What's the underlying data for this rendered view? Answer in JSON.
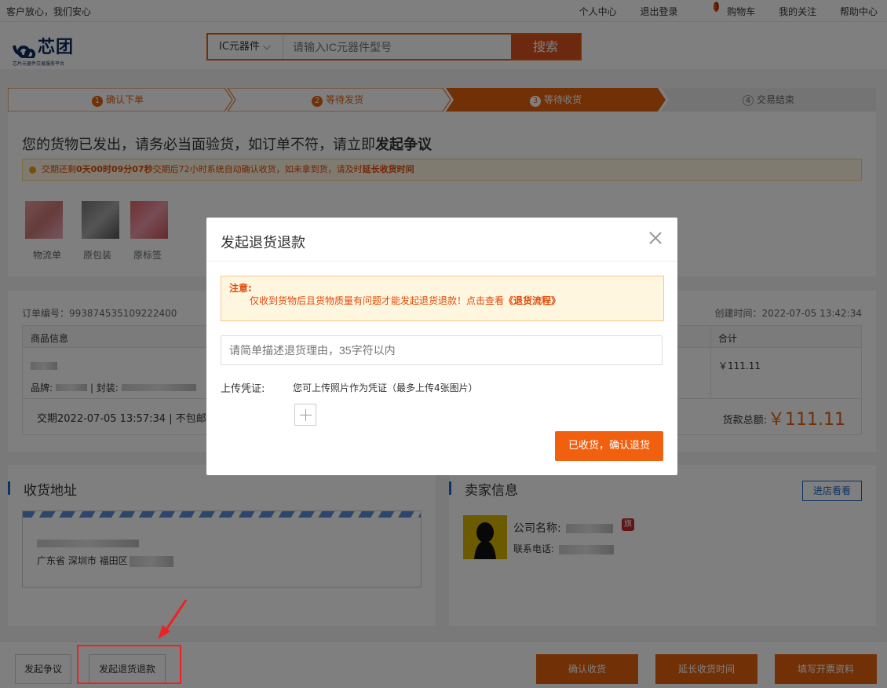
{
  "topbar": {
    "slogan": "客户放心，我们安心",
    "links": [
      "个人中心",
      "退出登录",
      "购物车",
      "我的关注",
      "帮助中心"
    ],
    "cart_count": "3"
  },
  "logo": {
    "text": "芯团",
    "sub": "芯片元器件交易服务平台"
  },
  "search": {
    "category": "IC元器件 ⌵",
    "placeholder": "请输入IC元器件型号",
    "button": "搜索"
  },
  "steps": [
    {
      "num": "1",
      "label": "确认下单"
    },
    {
      "num": "2",
      "label": "等待发货"
    },
    {
      "num": "3",
      "label": "等待收货"
    },
    {
      "num": "4",
      "label": "交易结束"
    }
  ],
  "status": {
    "text": "您的货物已发出，请务必当面验货，如订单不符，请立即",
    "bold": "发起争议",
    "notice_pre": "交期还剩",
    "notice_countdown": "0天00时09分07秒",
    "notice_post": "交期后72小时系统自动确认收货，如未拿到货，请及时",
    "notice_link": "延长收货时间"
  },
  "thumbs": [
    "物流单",
    "原包装",
    "原标签"
  ],
  "order": {
    "number_label": "订单编号：993874535109222400",
    "created": "创建时间：2022-07-05 13:42:34",
    "col_product": "商品信息",
    "col_total": "合计",
    "brand_label": "品牌:",
    "package_label": "| 封装:",
    "price": "￥111.11",
    "deal": "交期2022-07-05 13:57:34 | 不包邮（",
    "total_label": "货款总额:",
    "total": "￥111.11"
  },
  "address": {
    "title": "收货地址",
    "line": "广东省 深圳市 福田区"
  },
  "seller": {
    "title": "卖家信息",
    "visit": "进店看看",
    "company": "公司名称:",
    "phone": "联系电话:",
    "flag": "旗"
  },
  "bottom": {
    "dispute": "发起争议",
    "refund": "发起退货退款",
    "confirm": "确认收货",
    "extend": "延长收货时间",
    "invoice": "填写开票资料"
  },
  "modal": {
    "title": "发起退货退款",
    "warn_title": "注意:",
    "warn_text": "仅收到货物后且货物质量有问题才能发起退货退款！点击查看",
    "warn_link": "《退货流程》",
    "reason_placeholder": "请简单描述退货理由，35字符以内",
    "upload_label": "上传凭证:",
    "upload_hint": "您可上传照片作为凭证（最多上传4张图片）",
    "confirm": "已收货，确认退货"
  }
}
